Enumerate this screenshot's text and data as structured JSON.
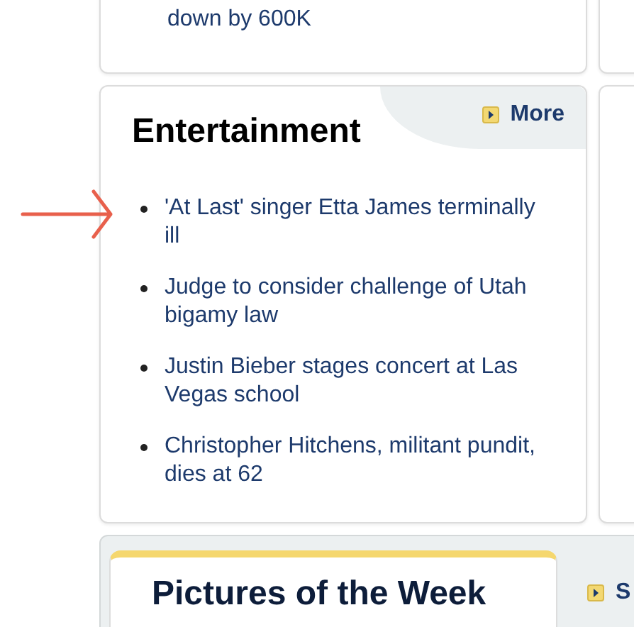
{
  "top_story": {
    "text": "down by 600K"
  },
  "entertainment": {
    "title": "Entertainment",
    "more_link": "More",
    "headlines": [
      {
        "text": "'At Last' singer Etta James terminally ill"
      },
      {
        "text": "Judge to consider challenge of Utah bigamy law"
      },
      {
        "text": "Justin Bieber stages concert at Las Vegas school"
      },
      {
        "text": "Christopher Hitchens, militant pundit, dies at 62"
      }
    ]
  },
  "pictures": {
    "title": "Pictures of the Week",
    "link": "S"
  }
}
